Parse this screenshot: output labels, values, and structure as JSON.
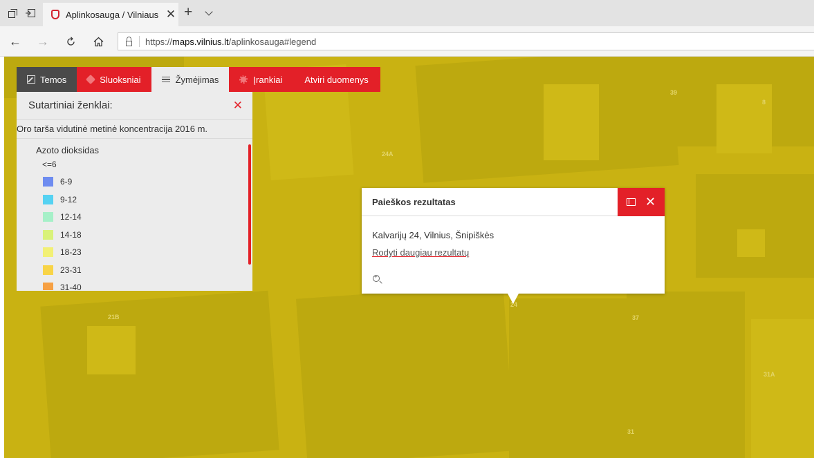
{
  "browser": {
    "tab_title": "Aplinkosauga / Vilniaus",
    "tab_close": "✕",
    "new_tab": "+",
    "url_prefix": "https://",
    "url_domain": "maps.vilnius.lt",
    "url_path": "/aplinkosauga#legend",
    "icons": [
      "tab-set-aside-icon",
      "tab-preview-icon",
      "favicon",
      "back-icon",
      "forward-icon",
      "refresh-icon",
      "home-icon",
      "lock-icon"
    ]
  },
  "toolbar": {
    "items": [
      {
        "label": "Temos",
        "icon": "edit-icon"
      },
      {
        "label": "Sluoksniai",
        "icon": "layers-icon"
      },
      {
        "label": "Žymėjimas",
        "icon": "list-icon"
      },
      {
        "label": "Įrankiai",
        "icon": "gear-icon"
      },
      {
        "label": "Atviri duomenys",
        "icon": ""
      }
    ]
  },
  "legend": {
    "title": "Sutartiniai ženklai:",
    "close": "✕",
    "layer_name": "Oro tarša vidutinė metinė koncentracija 2016 m.",
    "sublayer": "Azoto dioksidas",
    "items": [
      {
        "label": "<=6",
        "color": ""
      },
      {
        "label": "6-9",
        "color": "#6e8cf0"
      },
      {
        "label": "9-12",
        "color": "#55d2f2"
      },
      {
        "label": "12-14",
        "color": "#a6f0c8"
      },
      {
        "label": "14-18",
        "color": "#d9f27a"
      },
      {
        "label": "18-23",
        "color": "#f2f075"
      },
      {
        "label": "23-31",
        "color": "#f8d447"
      },
      {
        "label": "31-40",
        "color": "#f6a043"
      }
    ]
  },
  "popup": {
    "title": "Paieškos rezultatas",
    "address": "Kalvarijų 24, Vilnius, Šnipiškės",
    "more_link": "Rodyti daugiau rezultatų",
    "close": "✕"
  },
  "map": {
    "labels": [
      "39",
      "8",
      "24A",
      "21B",
      "37",
      "31A",
      "31",
      "24"
    ],
    "base_color": "#c9b212"
  }
}
